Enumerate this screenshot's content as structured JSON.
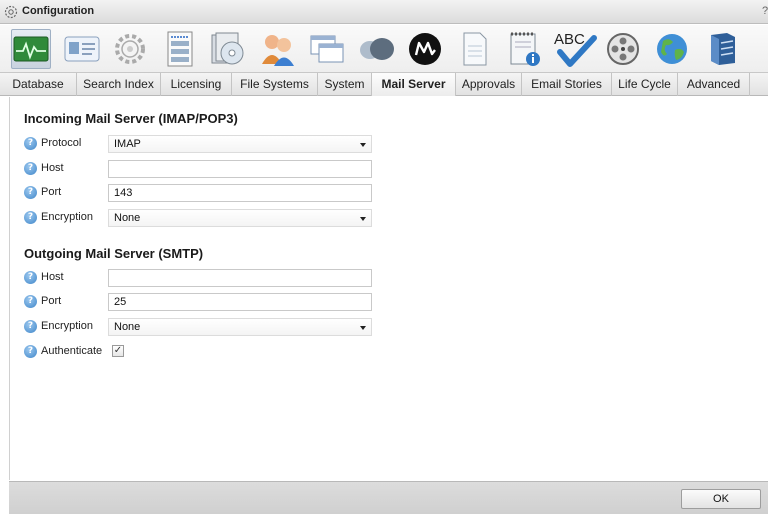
{
  "window": {
    "title": "Configuration",
    "help_glyph": "?"
  },
  "toolbar_icons": [
    {
      "name": "database-monitor-icon"
    },
    {
      "name": "id-card-icon"
    },
    {
      "name": "licensing-gear-icon"
    },
    {
      "name": "filesystem-server-icon"
    },
    {
      "name": "disc-files-icon"
    },
    {
      "name": "users-icon"
    },
    {
      "name": "windows-icon"
    },
    {
      "name": "clouds-icon"
    },
    {
      "name": "mail-server-m-icon"
    },
    {
      "name": "document-icon"
    },
    {
      "name": "notepad-info-icon"
    },
    {
      "name": "abc-spellcheck-icon",
      "text": "ABC"
    },
    {
      "name": "film-reel-icon"
    },
    {
      "name": "globe-icon"
    },
    {
      "name": "server-stack-icon"
    }
  ],
  "tabs": [
    "Database",
    "Search Index",
    "Licensing",
    "File Systems",
    "System",
    "Mail Server",
    "Approvals",
    "Email Stories",
    "Life Cycle",
    "Advanced"
  ],
  "active_tab": "Mail Server",
  "incoming": {
    "title": "Incoming Mail Server (IMAP/POP3)",
    "protocol_label": "Protocol",
    "protocol_value": "IMAP",
    "host_label": "Host",
    "host_value": "",
    "port_label": "Port",
    "port_value": "143",
    "encryption_label": "Encryption",
    "encryption_value": "None"
  },
  "outgoing": {
    "title": "Outgoing Mail Server (SMTP)",
    "host_label": "Host",
    "host_value": "",
    "port_label": "Port",
    "port_value": "25",
    "encryption_label": "Encryption",
    "encryption_value": "None",
    "authenticate_label": "Authenticate",
    "authenticate_checked": true,
    "check_glyph": "✓"
  },
  "help_icon_glyph": "?",
  "footer": {
    "ok_label": "OK"
  },
  "colors": {
    "accent_blue": "#3f86c9",
    "tab_bar": "#e2e2e2",
    "footer": "#d6d6d6"
  }
}
